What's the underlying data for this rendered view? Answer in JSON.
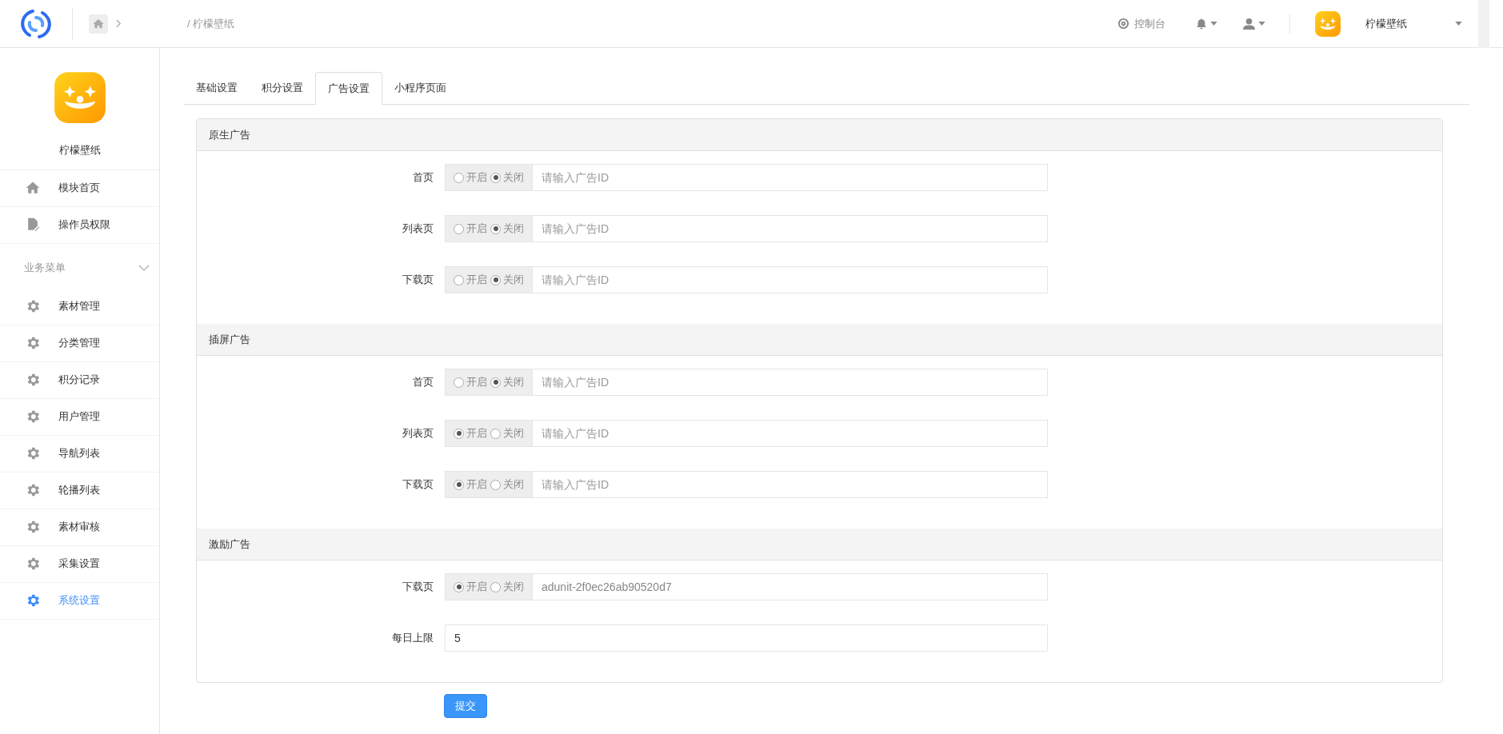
{
  "header": {
    "breadcrumb": "/ 柠檬壁纸",
    "console": "控制台",
    "user_name": "柠檬壁纸"
  },
  "sidebar": {
    "app_name": "柠檬壁纸",
    "top_items": [
      {
        "label": "模块首页",
        "kind": "home",
        "selected": false
      },
      {
        "label": "操作员权限",
        "kind": "doc",
        "selected": false
      }
    ],
    "group": {
      "title": "业务菜单",
      "expanded": true,
      "items": [
        {
          "label": "素材管理",
          "kind": "gear",
          "selected": false
        },
        {
          "label": "分类管理",
          "kind": "gear",
          "selected": false
        },
        {
          "label": "积分记录",
          "kind": "gear",
          "selected": false
        },
        {
          "label": "用户管理",
          "kind": "gear",
          "selected": false
        },
        {
          "label": "导航列表",
          "kind": "gear",
          "selected": false
        },
        {
          "label": "轮播列表",
          "kind": "gear",
          "selected": false
        },
        {
          "label": "素材审核",
          "kind": "gear",
          "selected": false
        },
        {
          "label": "采集设置",
          "kind": "gear",
          "selected": false
        },
        {
          "label": "系统设置",
          "kind": "gear",
          "selected": true
        }
      ]
    }
  },
  "tabs": [
    {
      "label": "基础设置",
      "selected": false
    },
    {
      "label": "积分设置",
      "selected": false
    },
    {
      "label": "广告设置",
      "selected": true
    },
    {
      "label": "小程序页面",
      "selected": false
    }
  ],
  "sections": [
    {
      "title": "原生广告",
      "rows": [
        {
          "label": "首页",
          "kind": "toggle",
          "options": [
            {
              "label": "开启",
              "selected": false
            },
            {
              "label": "关闭",
              "selected": true
            }
          ],
          "placeholder": "请输入广告ID"
        },
        {
          "label": "列表页",
          "kind": "toggle",
          "options": [
            {
              "label": "开启",
              "selected": false
            },
            {
              "label": "关闭",
              "selected": true
            }
          ],
          "placeholder": "请输入广告ID"
        },
        {
          "label": "下载页",
          "kind": "toggle",
          "options": [
            {
              "label": "开启",
              "selected": false
            },
            {
              "label": "关闭",
              "selected": true
            }
          ],
          "placeholder": "请输入广告ID"
        }
      ]
    },
    {
      "title": "插屏广告",
      "rows": [
        {
          "label": "首页",
          "kind": "toggle",
          "options": [
            {
              "label": "开启",
              "selected": false
            },
            {
              "label": "关闭",
              "selected": true
            }
          ],
          "placeholder": "请输入广告ID"
        },
        {
          "label": "列表页",
          "kind": "toggle",
          "options": [
            {
              "label": "开启",
              "selected": true
            },
            {
              "label": "关闭",
              "selected": false
            }
          ],
          "placeholder": "请输入广告ID"
        },
        {
          "label": "下载页",
          "kind": "toggle",
          "options": [
            {
              "label": "开启",
              "selected": true
            },
            {
              "label": "关闭",
              "selected": false
            }
          ],
          "placeholder": "请输入广告ID"
        }
      ]
    },
    {
      "title": "激励广告",
      "rows": [
        {
          "label": "下载页",
          "kind": "toggle",
          "options": [
            {
              "label": "开启",
              "selected": true
            },
            {
              "label": "关闭",
              "selected": false
            }
          ],
          "value": "adunit-2f0ec26ab90520d7"
        },
        {
          "label": "每日上限",
          "kind": "text",
          "value": "5"
        }
      ]
    }
  ],
  "submit": "提交"
}
